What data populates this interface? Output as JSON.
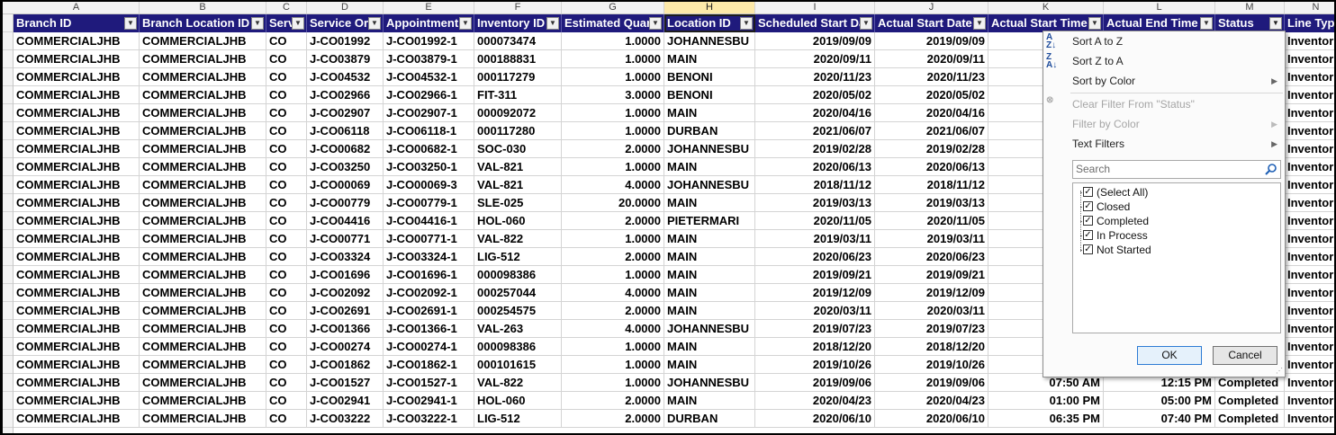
{
  "column_letters": [
    "A",
    "B",
    "C",
    "D",
    "E",
    "F",
    "G",
    "H",
    "I",
    "J",
    "K",
    "L",
    "M",
    "N"
  ],
  "selected_column_letter": "H",
  "headers": [
    "Branch ID",
    "Branch Location ID",
    "Serv",
    "Service Or",
    "Appointment",
    "Inventory ID",
    "Estimated Quar",
    "Location ID",
    "Scheduled Start Da",
    "Actual Start Date",
    "Actual Start Time",
    "Actual End Time",
    "Status",
    "Line Typ"
  ],
  "rows": [
    [
      "COMMERCIALJHB",
      "COMMERCIALJHB",
      "CO",
      "J-CO01992",
      "J-CO01992-1",
      "000073474",
      "1.0000",
      "JOHANNESBU",
      "2019/09/09",
      "2019/09/09",
      "",
      "",
      "",
      "Inventor"
    ],
    [
      "COMMERCIALJHB",
      "COMMERCIALJHB",
      "CO",
      "J-CO03879",
      "J-CO03879-1",
      "000188831",
      "1.0000",
      "MAIN",
      "2020/09/11",
      "2020/09/11",
      "",
      "",
      "",
      "Inventor"
    ],
    [
      "COMMERCIALJHB",
      "COMMERCIALJHB",
      "CO",
      "J-CO04532",
      "J-CO04532-1",
      "000117279",
      "1.0000",
      "BENONI",
      "2020/11/23",
      "2020/11/23",
      "",
      "",
      "",
      "Inventor"
    ],
    [
      "COMMERCIALJHB",
      "COMMERCIALJHB",
      "CO",
      "J-CO02966",
      "J-CO02966-1",
      "FIT-311",
      "3.0000",
      "BENONI",
      "2020/05/02",
      "2020/05/02",
      "",
      "",
      "",
      "Inventor"
    ],
    [
      "COMMERCIALJHB",
      "COMMERCIALJHB",
      "CO",
      "J-CO02907",
      "J-CO02907-1",
      "000092072",
      "1.0000",
      "MAIN",
      "2020/04/16",
      "2020/04/16",
      "",
      "",
      "",
      "Inventor"
    ],
    [
      "COMMERCIALJHB",
      "COMMERCIALJHB",
      "CO",
      "J-CO06118",
      "J-CO06118-1",
      "000117280",
      "1.0000",
      "DURBAN",
      "2021/06/07",
      "2021/06/07",
      "",
      "",
      "",
      "Inventor"
    ],
    [
      "COMMERCIALJHB",
      "COMMERCIALJHB",
      "CO",
      "J-CO00682",
      "J-CO00682-1",
      "SOC-030",
      "2.0000",
      "JOHANNESBU",
      "2019/02/28",
      "2019/02/28",
      "",
      "",
      "",
      "Inventor"
    ],
    [
      "COMMERCIALJHB",
      "COMMERCIALJHB",
      "CO",
      "J-CO03250",
      "J-CO03250-1",
      "VAL-821",
      "1.0000",
      "MAIN",
      "2020/06/13",
      "2020/06/13",
      "",
      "",
      "",
      "Inventor"
    ],
    [
      "COMMERCIALJHB",
      "COMMERCIALJHB",
      "CO",
      "J-CO00069",
      "J-CO00069-3",
      "VAL-821",
      "4.0000",
      "JOHANNESBU",
      "2018/11/12",
      "2018/11/12",
      "",
      "",
      "",
      "Inventor"
    ],
    [
      "COMMERCIALJHB",
      "COMMERCIALJHB",
      "CO",
      "J-CO00779",
      "J-CO00779-1",
      "SLE-025",
      "20.0000",
      "MAIN",
      "2019/03/13",
      "2019/03/13",
      "",
      "",
      "",
      "Inventor"
    ],
    [
      "COMMERCIALJHB",
      "COMMERCIALJHB",
      "CO",
      "J-CO04416",
      "J-CO04416-1",
      "HOL-060",
      "2.0000",
      "PIETERMARI",
      "2020/11/05",
      "2020/11/05",
      "",
      "",
      "",
      "Inventor"
    ],
    [
      "COMMERCIALJHB",
      "COMMERCIALJHB",
      "CO",
      "J-CO00771",
      "J-CO00771-1",
      "VAL-822",
      "1.0000",
      "MAIN",
      "2019/03/11",
      "2019/03/11",
      "",
      "",
      "",
      "Inventor"
    ],
    [
      "COMMERCIALJHB",
      "COMMERCIALJHB",
      "CO",
      "J-CO03324",
      "J-CO03324-1",
      "LIG-512",
      "2.0000",
      "MAIN",
      "2020/06/23",
      "2020/06/23",
      "",
      "",
      "",
      "Inventor"
    ],
    [
      "COMMERCIALJHB",
      "COMMERCIALJHB",
      "CO",
      "J-CO01696",
      "J-CO01696-1",
      "000098386",
      "1.0000",
      "MAIN",
      "2019/09/21",
      "2019/09/21",
      "",
      "",
      "",
      "Inventor"
    ],
    [
      "COMMERCIALJHB",
      "COMMERCIALJHB",
      "CO",
      "J-CO02092",
      "J-CO02092-1",
      "000257044",
      "4.0000",
      "MAIN",
      "2019/12/09",
      "2019/12/09",
      "",
      "",
      "",
      "Inventor"
    ],
    [
      "COMMERCIALJHB",
      "COMMERCIALJHB",
      "CO",
      "J-CO02691",
      "J-CO02691-1",
      "000254575",
      "2.0000",
      "MAIN",
      "2020/03/11",
      "2020/03/11",
      "",
      "",
      "",
      "Inventor"
    ],
    [
      "COMMERCIALJHB",
      "COMMERCIALJHB",
      "CO",
      "J-CO01366",
      "J-CO01366-1",
      "VAL-263",
      "4.0000",
      "JOHANNESBU",
      "2019/07/23",
      "2019/07/23",
      "",
      "",
      "",
      "Inventor"
    ],
    [
      "COMMERCIALJHB",
      "COMMERCIALJHB",
      "CO",
      "J-CO00274",
      "J-CO00274-1",
      "000098386",
      "1.0000",
      "MAIN",
      "2018/12/20",
      "2018/12/20",
      "",
      "",
      "",
      "Inventor"
    ],
    [
      "COMMERCIALJHB",
      "COMMERCIALJHB",
      "CO",
      "J-CO01862",
      "J-CO01862-1",
      "000101615",
      "1.0000",
      "MAIN",
      "2019/10/26",
      "2019/10/26",
      "",
      "",
      "",
      "Inventor"
    ],
    [
      "COMMERCIALJHB",
      "COMMERCIALJHB",
      "CO",
      "J-CO01527",
      "J-CO01527-1",
      "VAL-822",
      "1.0000",
      "JOHANNESBU",
      "2019/09/06",
      "2019/09/06",
      "07:50 AM",
      "12:15 PM",
      "Completed",
      "Inventor"
    ],
    [
      "COMMERCIALJHB",
      "COMMERCIALJHB",
      "CO",
      "J-CO02941",
      "J-CO02941-1",
      "HOL-060",
      "2.0000",
      "MAIN",
      "2020/04/23",
      "2020/04/23",
      "01:00 PM",
      "05:00 PM",
      "Completed",
      "Inventor"
    ],
    [
      "COMMERCIALJHB",
      "COMMERCIALJHB",
      "CO",
      "J-CO03222",
      "J-CO03222-1",
      "LIG-512",
      "2.0000",
      "DURBAN",
      "2020/06/10",
      "2020/06/10",
      "06:35 PM",
      "07:40 PM",
      "Completed",
      "Inventor"
    ]
  ],
  "filter_menu": {
    "sort_asc": "Sort A to Z",
    "sort_desc": "Sort Z to A",
    "sort_by_color": "Sort by Color",
    "clear_filter": "Clear Filter From \"Status\"",
    "filter_by_color": "Filter by Color",
    "text_filters": "Text Filters",
    "search_placeholder": "Search",
    "items": [
      "(Select All)",
      "Closed",
      "Completed",
      "In Process",
      "Not Started"
    ],
    "ok": "OK",
    "cancel": "Cancel"
  },
  "colors": {
    "header_bg": "#1f1a7c",
    "header_text": "#ffffff",
    "selected_col": "#fde9a9"
  }
}
